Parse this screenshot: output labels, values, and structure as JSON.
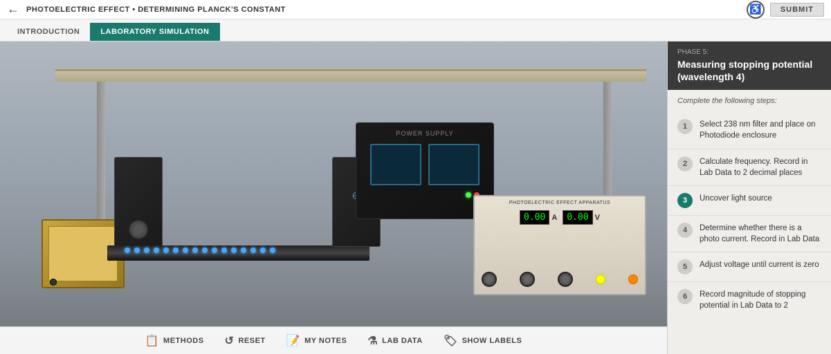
{
  "header": {
    "title": "PHOTOELECTRIC EFFECT • DETERMINING PLANCK'S CONSTANT",
    "back_label": "←",
    "submit_label": "SUBMIT",
    "accessibility_icon": "♿"
  },
  "tabs": [
    {
      "label": "INTRODUCTION",
      "active": false
    },
    {
      "label": "LABORATORY SIMULATION",
      "active": true
    }
  ],
  "phase": {
    "label": "PHASE 5:",
    "title": "Measuring stopping potential (wavelength 4)"
  },
  "steps_intro": "Complete the following steps:",
  "steps": [
    {
      "number": "1",
      "text": "Select 238 nm filter and place on Photodiode enclosure",
      "active": false
    },
    {
      "number": "2",
      "text": "Calculate frequency. Record in Lab Data to 2 decimal places",
      "active": false
    },
    {
      "number": "3",
      "text": "Uncover light source",
      "active": true
    },
    {
      "number": "4",
      "text": "Determine whether there is a photo current. Record in Lab Data",
      "active": false
    },
    {
      "number": "5",
      "text": "Adjust voltage until current is zero",
      "active": false
    },
    {
      "number": "6",
      "text": "Record magnitude of stopping potential in Lab Data to 2",
      "active": false
    }
  ],
  "toolbar": {
    "methods_label": "METHODS",
    "reset_label": "RESET",
    "notes_label": "MY NOTES",
    "lab_data_label": "LAB DATA",
    "show_labels_label": "SHOW LABELS",
    "methods_icon": "📋",
    "reset_icon": "↺",
    "notes_icon": "📝",
    "lab_icon": "⚗",
    "labels_icon": "🏷"
  },
  "apparatus": {
    "title": "PHOTOELECTRIC EFFECT APPARATUS",
    "current_value": "0.00",
    "current_unit": "A",
    "voltage_value": "0.00",
    "voltage_unit": "V"
  },
  "power_supply": {
    "label": "POWER SUPPLY"
  },
  "rail_dot_count": 16
}
